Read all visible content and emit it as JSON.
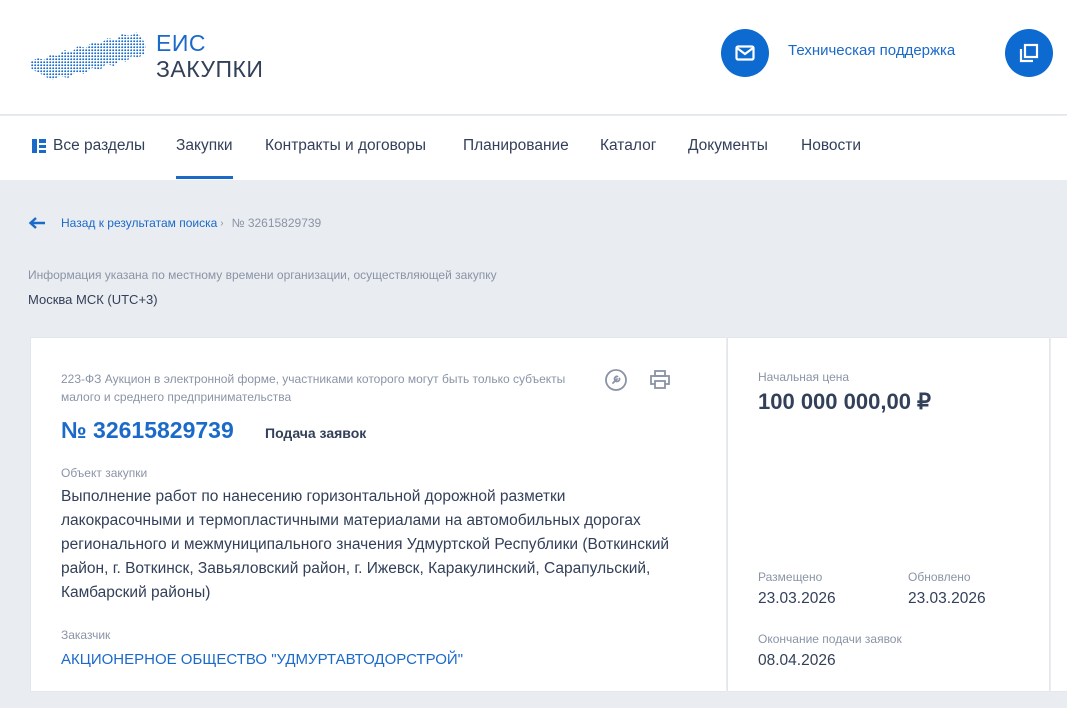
{
  "header": {
    "logo_line1": "ЕИС",
    "logo_line2": "ЗАКУПКИ",
    "support_label": "Техническая поддержка",
    "accent_color": "#0d6ad0"
  },
  "nav": {
    "items": [
      {
        "label": "Все разделы",
        "icon": "sections-icon"
      },
      {
        "label": "Закупки",
        "active": true
      },
      {
        "label": "Контракты и договоры"
      },
      {
        "label": "Планирование"
      },
      {
        "label": "Каталог"
      },
      {
        "label": "Документы"
      },
      {
        "label": "Новости"
      }
    ]
  },
  "breadcrumb": {
    "back_label": "Назад к результатам поиска",
    "current": "№ 32615829739"
  },
  "timezone": {
    "note": "Информация указана по местному времени организации, осуществляющей закупку",
    "value": "Москва МСК (UTC+3)"
  },
  "card": {
    "procedure_type": "223-ФЗ Аукцион в электронной форме, участниками которого могут быть только субъекты малого и среднего предпринимательства",
    "number": "№ 32615829739",
    "status": "Подача заявок",
    "object_label": "Объект закупки",
    "object_text": "Выполнение работ по нанесению горизонтальной дорожной разметки лакокрасочными и термопластичными материалами на автомобильных дорогах регионального и межмуниципального значения Удмуртской Республики (Воткинский район, г. Воткинск, Завьяловский район, г. Ижевск, Каракулинский, Сарапульский, Камбарский районы)",
    "customer_label": "Заказчик",
    "customer_name": "АКЦИОНЕРНОЕ ОБЩЕСТВО \"УДМУРТАВТОДОРСТРОЙ\"",
    "price_label": "Начальная цена",
    "price_value": "100 000 000,00 ₽",
    "posted_label": "Размещено",
    "posted_date": "23.03.2026",
    "updated_label": "Обновлено",
    "updated_date": "23.03.2026",
    "deadline_label": "Окончание подачи заявок",
    "deadline_date": "08.04.2026"
  }
}
